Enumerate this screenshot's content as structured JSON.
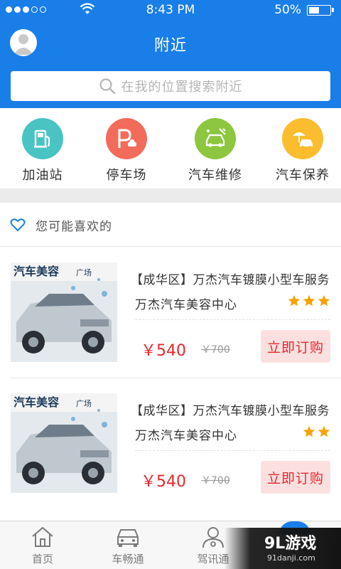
{
  "status_bar": {
    "time": "8:43 PM",
    "battery": "50%",
    "battery_level": 0.5
  },
  "header": {
    "title": "附近"
  },
  "search": {
    "placeholder": "在我的位置搜索附近"
  },
  "categories": [
    {
      "label": "加油站",
      "icon": "gas-station-icon",
      "color": "#4ac3c3"
    },
    {
      "label": "停车场",
      "icon": "parking-icon",
      "color": "#f26b5b"
    },
    {
      "label": "汽车维修",
      "icon": "car-repair-icon",
      "color": "#8dc63f"
    },
    {
      "label": "汽车保养",
      "icon": "car-maintenance-icon",
      "color": "#fbbd2e"
    }
  ],
  "recommend": {
    "title": "您可能喜欢的",
    "icon": "heart-outline-icon"
  },
  "items": [
    {
      "name": "【成华区】万杰汽车镀膜小型车服务",
      "shop": "万杰汽车美容中心",
      "rating": 3,
      "price": "￥540",
      "old_price": "￥700",
      "button": "立即订购",
      "thumb_title": "汽车美容",
      "thumb_tag": "广场"
    },
    {
      "name": "【成华区】万杰汽车镀膜小型车服务",
      "shop": "万杰汽车美容中心",
      "rating": 2,
      "price": "￥540",
      "old_price": "￥700",
      "button": "立即订购",
      "thumb_title": "汽车美容",
      "thumb_tag": "广场"
    }
  ],
  "tabs": [
    {
      "label": "首页",
      "icon": "home-icon"
    },
    {
      "label": "车畅通",
      "icon": "car-icon"
    },
    {
      "label": "驾讯通",
      "icon": "driver-icon"
    }
  ],
  "watermark": {
    "brand": "9L游戏",
    "url": "91danji.com"
  },
  "colors": {
    "brand": "#1a7ee8",
    "price": "#e8262a",
    "star": "#f6a300"
  }
}
